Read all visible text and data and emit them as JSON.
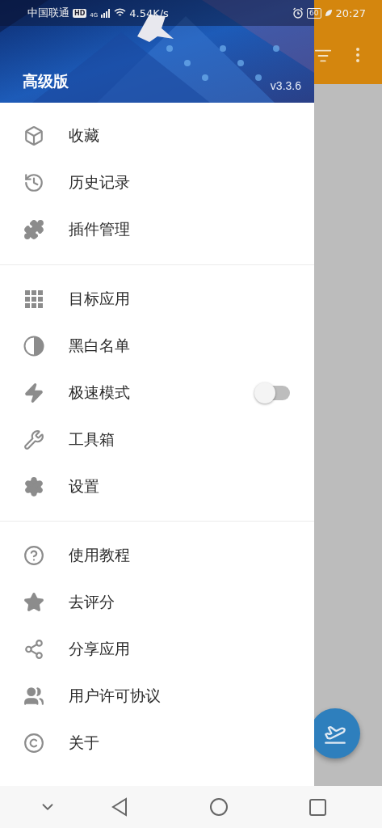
{
  "status_bar": {
    "carrier": "中国联通",
    "hd_badge": "HD",
    "network_type": "4G",
    "network_speed": "4.54K/s",
    "battery": "60",
    "time": "20:27"
  },
  "header": {
    "title": "高级版",
    "version": "v3.3.6"
  },
  "menu_sections": [
    {
      "items": [
        {
          "label": "收藏",
          "kind": "link"
        },
        {
          "label": "历史记录",
          "kind": "link"
        },
        {
          "label": "插件管理",
          "kind": "link"
        }
      ]
    },
    {
      "items": [
        {
          "label": "目标应用",
          "kind": "link"
        },
        {
          "label": "黑白名单",
          "kind": "link"
        },
        {
          "label": "极速模式",
          "kind": "switch",
          "on": false
        },
        {
          "label": "工具箱",
          "kind": "link"
        },
        {
          "label": "设置",
          "kind": "link"
        }
      ]
    },
    {
      "items": [
        {
          "label": "使用教程",
          "kind": "link"
        },
        {
          "label": "去评分",
          "kind": "link"
        },
        {
          "label": "分享应用",
          "kind": "link"
        },
        {
          "label": "用户许可协议",
          "kind": "link"
        },
        {
          "label": "关于",
          "kind": "link"
        }
      ]
    }
  ]
}
